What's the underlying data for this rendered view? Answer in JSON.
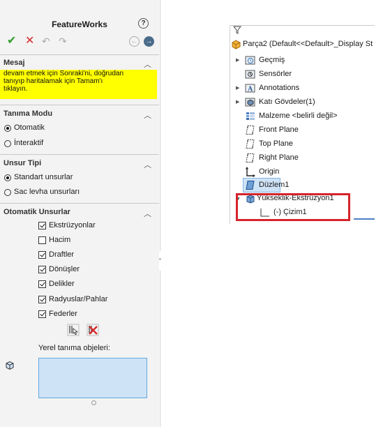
{
  "property_manager": {
    "title": "FeatureWorks",
    "help_icon": "question-mark-icon",
    "sections": {
      "message": {
        "header": "Mesaj",
        "lines": [
          "devam etmek için Sonraki'ni, doğrudan",
          "tanıyıp haritalamak için Tamam'ı",
          "tıklayın."
        ]
      },
      "recognition_mode": {
        "header": "Tanıma Modu",
        "options": [
          "Otomatik",
          "İnteraktif"
        ],
        "selected": "Otomatik"
      },
      "feature_type": {
        "header": "Unsur Tipi",
        "options": [
          "Standart unsurlar",
          "Sac levha unsurları"
        ],
        "selected": "Standart unsurlar"
      },
      "auto_features": {
        "header": "Otomatik Unsurlar",
        "items": [
          {
            "label": "Ekstrüzyonlar",
            "checked": true
          },
          {
            "label": "Hacim",
            "checked": false
          },
          {
            "label": "Draftler",
            "checked": true
          },
          {
            "label": "Dönüşler",
            "checked": true
          },
          {
            "label": "Delikler",
            "checked": true
          },
          {
            "label": "Radyuslar/Pahlar",
            "checked": true
          },
          {
            "label": "Federler",
            "checked": true
          }
        ],
        "local_objects_label": "Yerel tanıma objeleri:"
      }
    },
    "colors": {
      "message_bg": "#ffff00",
      "ok": "#2f9e2f",
      "cancel": "#d52b2b",
      "selection": "#cfe3f7"
    }
  },
  "feature_tree": {
    "root": "Parça2  (Default<<Default>_Display St",
    "items": [
      {
        "label": "Geçmiş",
        "icon": "history-folder-icon",
        "expandable": true
      },
      {
        "label": "Sensörler",
        "icon": "sensors-icon",
        "expandable": false
      },
      {
        "label": "Annotations",
        "icon": "annotations-icon",
        "expandable": true
      },
      {
        "label": "Katı Gövdeler(1)",
        "icon": "solid-bodies-icon",
        "expandable": true
      },
      {
        "label": "Malzeme <belirli değil>",
        "icon": "material-icon",
        "expandable": false
      },
      {
        "label": "Front Plane",
        "icon": "plane-icon",
        "expandable": false
      },
      {
        "label": "Top Plane",
        "icon": "plane-icon",
        "expandable": false
      },
      {
        "label": "Right Plane",
        "icon": "plane-icon",
        "expandable": false
      },
      {
        "label": "Origin",
        "icon": "origin-icon",
        "expandable": false
      },
      {
        "label": "Düzlem1",
        "icon": "plane-icon",
        "expandable": false,
        "selected": true
      },
      {
        "label": "Yükseklik-Ekstrüzyon1",
        "icon": "extrude-icon",
        "expandable": true,
        "expanded": true
      },
      {
        "label": "(-) Çizim1",
        "icon": "sketch-icon",
        "expandable": false
      }
    ],
    "highlight_color": "#d6232b"
  }
}
